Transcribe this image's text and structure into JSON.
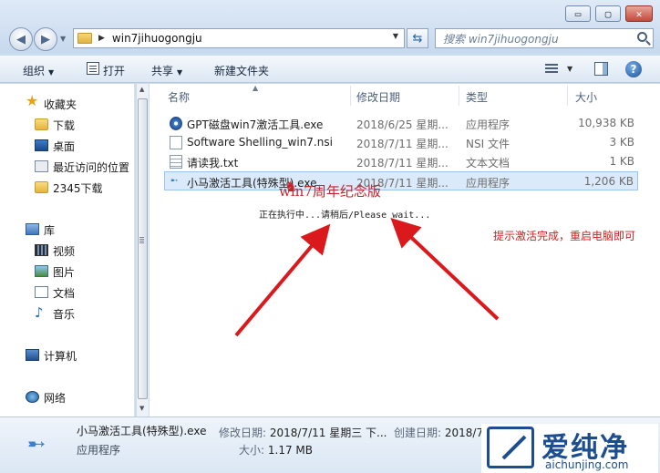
{
  "window": {
    "controls": {
      "minimize": "▭",
      "maximize": "▢",
      "close": "✕"
    }
  },
  "address_bar": {
    "path": "win7jihuogongju",
    "search_placeholder": "搜索 win7jihuogongju"
  },
  "toolbar": {
    "organize": "组织",
    "open": "打开",
    "share": "共享",
    "new_folder": "新建文件夹"
  },
  "nav": {
    "favorites_header": "收藏夹",
    "favorites": [
      "下载",
      "桌面",
      "最近访问的位置",
      "2345下载"
    ],
    "libraries_header": "库",
    "libraries": [
      "视频",
      "图片",
      "文档",
      "音乐"
    ],
    "computer": "计算机",
    "network": "网络"
  },
  "columns": {
    "name": "名称",
    "modified": "修改日期",
    "type": "类型",
    "size": "大小"
  },
  "files": [
    {
      "name": "GPT磁盘win7激活工具.exe",
      "modified": "2018/6/25 星期...",
      "type": "应用程序",
      "size": "10,938 KB",
      "icon": "gpt-icon"
    },
    {
      "name": "Software Shelling_win7.nsi",
      "modified": "2018/7/11 星期...",
      "type": "NSI 文件",
      "size": "3 KB",
      "icon": "nsi-file-icon"
    },
    {
      "name": "请读我.txt",
      "modified": "2018/7/11 星期...",
      "type": "文本文档",
      "size": "1 KB",
      "icon": "text-file-icon"
    },
    {
      "name": "小马激活工具(特殊型).exe",
      "modified": "2018/7/11 星期...",
      "type": "应用程序",
      "size": "1,206 KB",
      "icon": "horse-exe-icon"
    }
  ],
  "popup": {
    "brand": "win7周年纪念版",
    "status": "正在执行中...请稍后/Please wait..."
  },
  "annotation": "提示激活完成，重启电脑即可",
  "details": {
    "name": "小马激活工具(特殊型).exe",
    "type": "应用程序",
    "modified_label": "修改日期:",
    "modified_value": "2018/7/11 星期三 下...",
    "created_label": "创建日期:",
    "created_value": "2018/7",
    "size_label": "大小:",
    "size_value": "1.17 MB"
  },
  "watermark": {
    "text": "爱纯净",
    "url": "aichunjing.com"
  },
  "colors": {
    "annotation": "#d21f1f",
    "arrow": "#d9191c",
    "brand": "#c8232c"
  }
}
